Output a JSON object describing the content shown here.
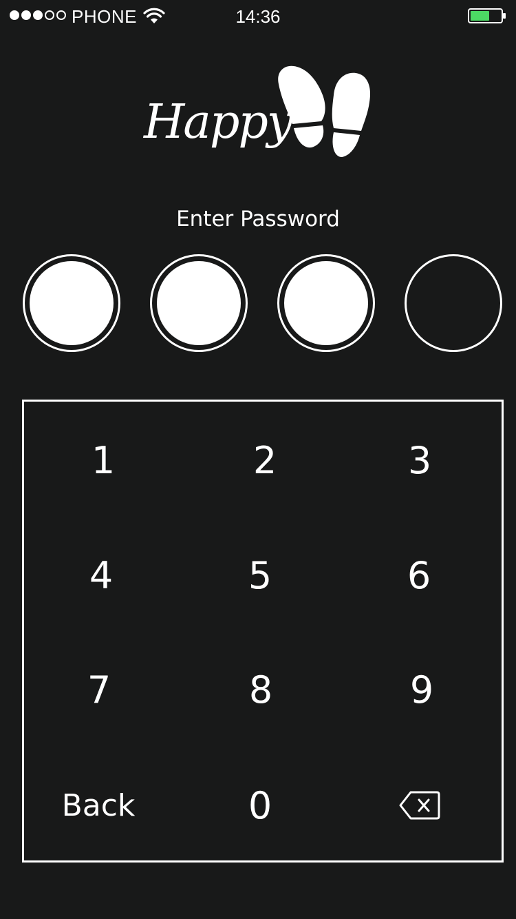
{
  "status_bar": {
    "signal_dots": [
      true,
      true,
      true,
      false,
      false
    ],
    "carrier": "PHONE",
    "time": "14:36",
    "battery_color": "#4cd964"
  },
  "logo": {
    "text": "Happy",
    "icon": "footprints-icon"
  },
  "password": {
    "prompt": "Enter Password",
    "length": 4,
    "entered": 3
  },
  "keypad": {
    "keys": [
      {
        "label": "1",
        "type": "digit"
      },
      {
        "label": "2",
        "type": "digit"
      },
      {
        "label": "3",
        "type": "digit"
      },
      {
        "label": "4",
        "type": "digit"
      },
      {
        "label": "5",
        "type": "digit"
      },
      {
        "label": "6",
        "type": "digit"
      },
      {
        "label": "7",
        "type": "digit"
      },
      {
        "label": "8",
        "type": "digit"
      },
      {
        "label": "9",
        "type": "digit"
      },
      {
        "label": "Back",
        "type": "back"
      },
      {
        "label": "0",
        "type": "digit"
      },
      {
        "label": "",
        "type": "delete",
        "icon": "backspace-icon"
      }
    ]
  },
  "colors": {
    "background": "#181919",
    "foreground": "#ffffff"
  }
}
